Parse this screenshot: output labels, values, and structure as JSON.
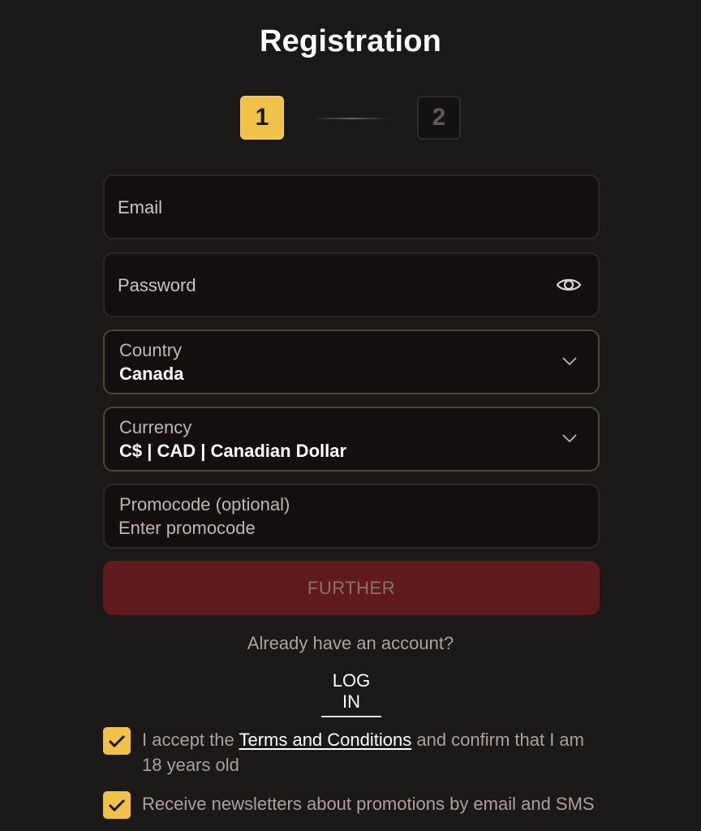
{
  "title": "Registration",
  "steps": {
    "step1": "1",
    "step2": "2",
    "current": 1
  },
  "email": {
    "label": "Email"
  },
  "password": {
    "label": "Password"
  },
  "country": {
    "label": "Country",
    "value": "Canada"
  },
  "currency": {
    "label": "Currency",
    "value": "C$ | CAD | Canadian Dollar"
  },
  "promocode": {
    "label": "Promocode (optional)",
    "placeholder": "Enter promocode"
  },
  "further_label": "FURTHER",
  "already_text": "Already have an account?",
  "login_label": "LOG IN",
  "terms": {
    "checked": true,
    "prefix": "I accept the ",
    "link": "Terms and Conditions",
    "suffix": " and confirm that I am 18 years old"
  },
  "newsletter": {
    "checked": true,
    "text": "Receive newsletters about promotions by email and SMS"
  },
  "colors": {
    "background": "#1b1818",
    "accent": "#f0c24a",
    "button": "#5e1a1c"
  }
}
